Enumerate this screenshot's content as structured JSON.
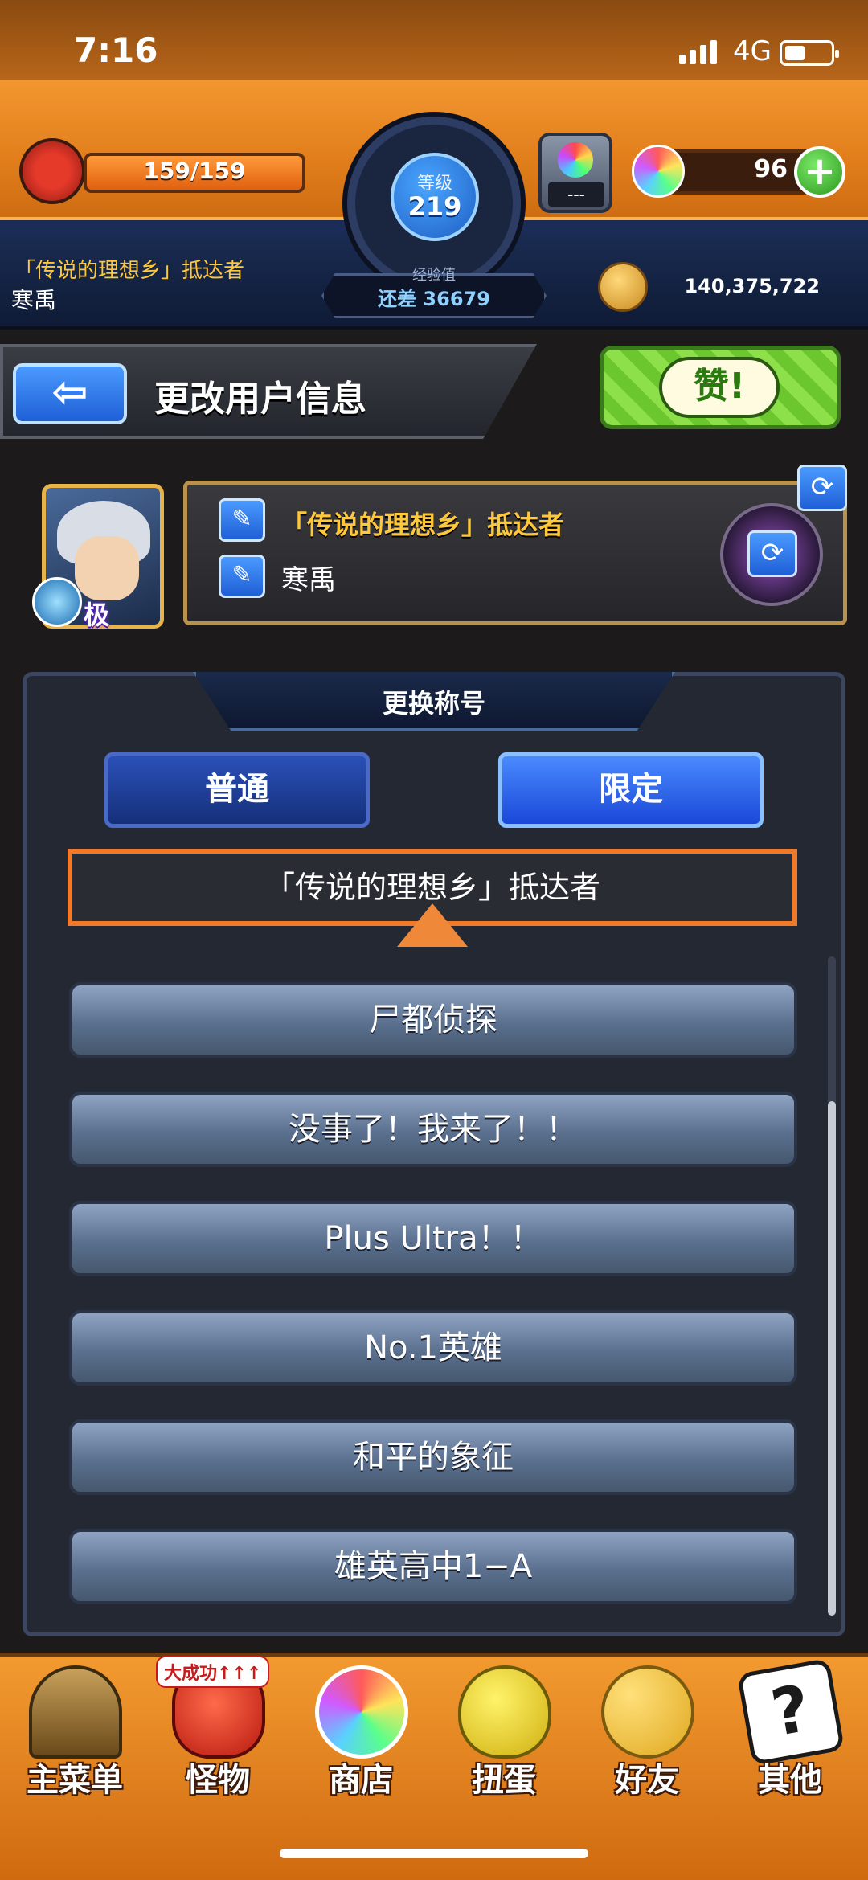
{
  "status_bar": {
    "time": "7:16",
    "network": "4G"
  },
  "hud": {
    "stamina": "159/159",
    "stamina_fraction": 1.0,
    "level_label": "等级",
    "level": "219",
    "exp_label": "经验值",
    "exp_remaining": "还差 36679",
    "gem_slot": "---",
    "orbs": "96",
    "player_title": "「传说的理想乡」抵达者",
    "player_name": "寒禹",
    "coins": "140,375,722"
  },
  "header": {
    "back_glyph": "⇦",
    "title": "更改用户信息",
    "like_label": "赞!"
  },
  "profile": {
    "rank": "极",
    "title": "「传说的理想乡」抵达者",
    "name": "寒禹",
    "refresh_glyph": "⟳"
  },
  "selector": {
    "heading": "更换称号",
    "tabs": [
      {
        "label": "普通",
        "active": false
      },
      {
        "label": "限定",
        "active": true
      }
    ],
    "current": "「传说的理想乡」抵达者",
    "items": [
      "尸都侦探",
      "没事了！我来了！！",
      "Plus Ultra！！",
      "No.1英雄",
      "和平的象征",
      "雄英高中1−A"
    ]
  },
  "bottom_nav": [
    {
      "label": "主菜单",
      "badge": ""
    },
    {
      "label": "怪物",
      "badge": "大成功↑↑↑"
    },
    {
      "label": "商店",
      "badge": ""
    },
    {
      "label": "扭蛋",
      "badge": ""
    },
    {
      "label": "好友",
      "badge": ""
    },
    {
      "label": "其他",
      "badge": ""
    }
  ],
  "colors": {
    "accent_orange": "#f07a2a",
    "hud_orange": "#f29630",
    "button_blue": "#1f5fd6",
    "like_green": "#8ee04a",
    "title_gold": "#ffc83a"
  }
}
